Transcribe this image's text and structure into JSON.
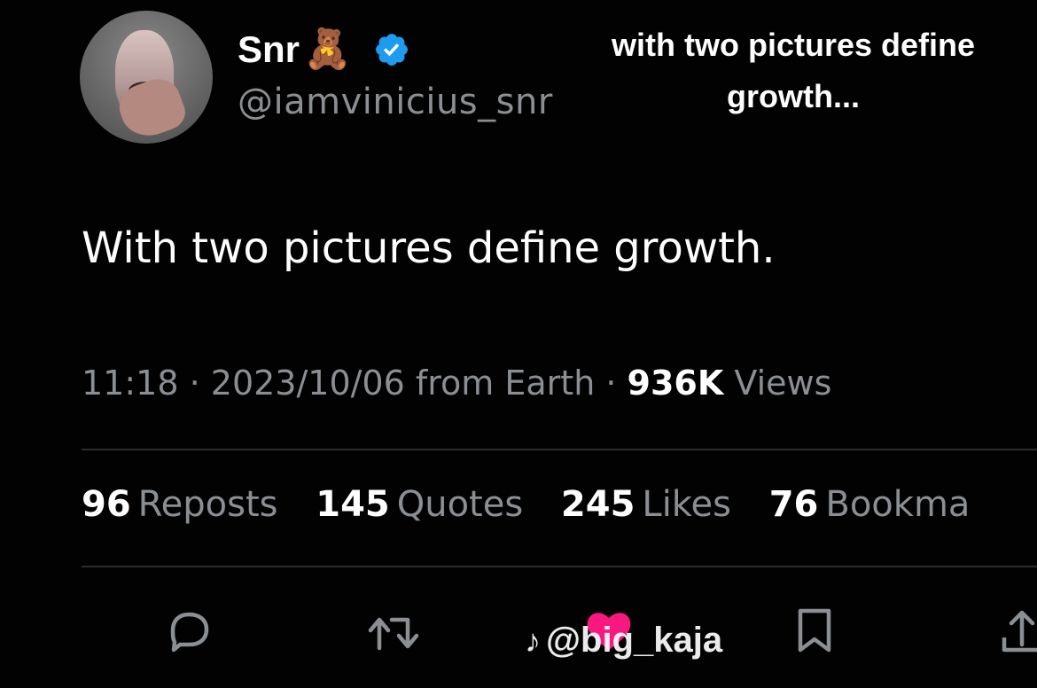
{
  "author": {
    "name": "Snr",
    "emoji": "🧸",
    "handle": "@iamvinicius_snr",
    "verified_color": "#1d9bf0"
  },
  "caption": {
    "line1": "with two pictures define",
    "line2": "growth..."
  },
  "tweet": {
    "text": "With two pictures define growth."
  },
  "meta": {
    "time": "11:18",
    "sep1": " · ",
    "date": "2023/10/06",
    "source": " from Earth",
    "sep2": " · ",
    "views_count": "936K",
    "views_label": " Views"
  },
  "stats": [
    {
      "count": "96",
      "label": "Reposts"
    },
    {
      "count": "145",
      "label": "Quotes"
    },
    {
      "count": "245",
      "label": "Likes"
    },
    {
      "count": "76",
      "label": "Bookma"
    }
  ],
  "actions": {
    "icons": [
      "reply-icon",
      "repost-icon",
      "like-icon",
      "bookmark-icon",
      "share-icon"
    ],
    "like_color": "#f91880"
  },
  "watermark": {
    "text": "@big_kaja"
  }
}
